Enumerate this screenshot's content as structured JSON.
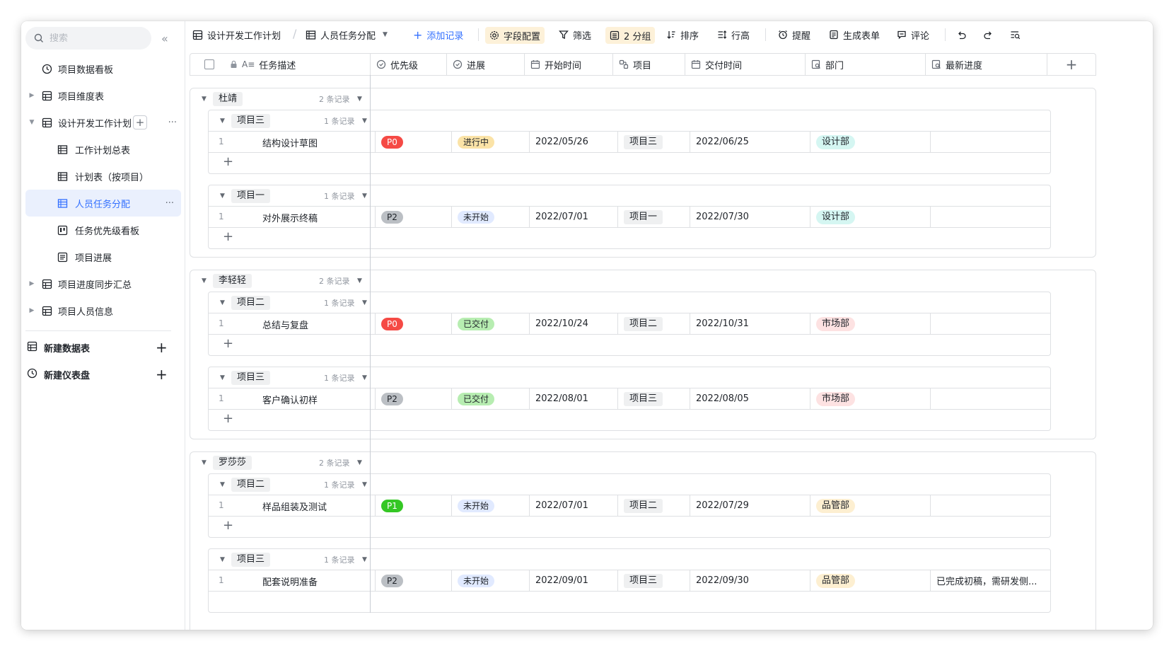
{
  "sidebar": {
    "search_placeholder": "搜索",
    "items": [
      {
        "label": "项目数据看板",
        "icon": "dashboard-icon"
      },
      {
        "label": "项目维度表",
        "icon": "table-icon"
      },
      {
        "label": "设计开发工作计划",
        "icon": "table-icon"
      },
      {
        "label": "工作计划总表",
        "icon": "grid-view-icon"
      },
      {
        "label": "计划表（按项目）",
        "icon": "grid-view-icon"
      },
      {
        "label": "人员任务分配",
        "icon": "grid-view-icon"
      },
      {
        "label": "任务优先级看板",
        "icon": "kanban-icon"
      },
      {
        "label": "项目进展",
        "icon": "form-icon"
      },
      {
        "label": "项目进度同步汇总",
        "icon": "table-icon"
      },
      {
        "label": "项目人员信息",
        "icon": "table-icon"
      }
    ],
    "create_table": "新建数据表",
    "create_dashboard": "新建仪表盘"
  },
  "toolbar": {
    "table_name": "设计开发工作计划",
    "view_name": "人员任务分配",
    "add_record": "添加记录",
    "field_config": "字段配置",
    "filter": "筛选",
    "group": "2 分组",
    "sort": "排序",
    "row_height": "行高",
    "reminder": "提醒",
    "generate_form": "生成表单",
    "comment": "评论"
  },
  "columns": [
    "任务描述",
    "优先级",
    "进展",
    "开始时间",
    "项目",
    "交付时间",
    "部门",
    "最新进度"
  ],
  "groups": [
    {
      "name": "杜靖",
      "count": "2 条记录",
      "subgroups": [
        {
          "name": "项目三",
          "count": "1 条记录",
          "row": {
            "num": "1",
            "desc": "结构设计草图",
            "priority": "P0",
            "status": "进行中",
            "start": "2022/05/26",
            "project": "项目三",
            "due": "2022/06/25",
            "dept": "设计部",
            "progress": ""
          }
        },
        {
          "name": "项目一",
          "count": "1 条记录",
          "row": {
            "num": "1",
            "desc": "对外展示终稿",
            "priority": "P2",
            "status": "未开始",
            "start": "2022/07/01",
            "project": "项目一",
            "due": "2022/07/30",
            "dept": "设计部",
            "progress": ""
          }
        }
      ]
    },
    {
      "name": "李轻轻",
      "count": "2 条记录",
      "subgroups": [
        {
          "name": "项目二",
          "count": "1 条记录",
          "row": {
            "num": "1",
            "desc": "总结与复盘",
            "priority": "P0",
            "status": "已交付",
            "start": "2022/10/24",
            "project": "项目二",
            "due": "2022/10/31",
            "dept": "市场部",
            "progress": ""
          }
        },
        {
          "name": "项目三",
          "count": "1 条记录",
          "row": {
            "num": "1",
            "desc": "客户确认初样",
            "priority": "P2",
            "status": "已交付",
            "start": "2022/08/01",
            "project": "项目三",
            "due": "2022/08/05",
            "dept": "市场部",
            "progress": ""
          }
        }
      ]
    },
    {
      "name": "罗莎莎",
      "count": "2 条记录",
      "subgroups": [
        {
          "name": "项目二",
          "count": "1 条记录",
          "row": {
            "num": "1",
            "desc": "样品组装及测试",
            "priority": "P1",
            "status": "未开始",
            "start": "2022/07/01",
            "project": "项目二",
            "due": "2022/07/29",
            "dept": "品管部",
            "progress": ""
          }
        },
        {
          "name": "项目三",
          "count": "1 条记录",
          "row": {
            "num": "1",
            "desc": "配套说明准备",
            "priority": "P2",
            "status": "未开始",
            "start": "2022/09/01",
            "project": "项目三",
            "due": "2022/09/30",
            "dept": "品管部",
            "progress": "已完成初稿，需研发侧..."
          }
        }
      ]
    }
  ]
}
